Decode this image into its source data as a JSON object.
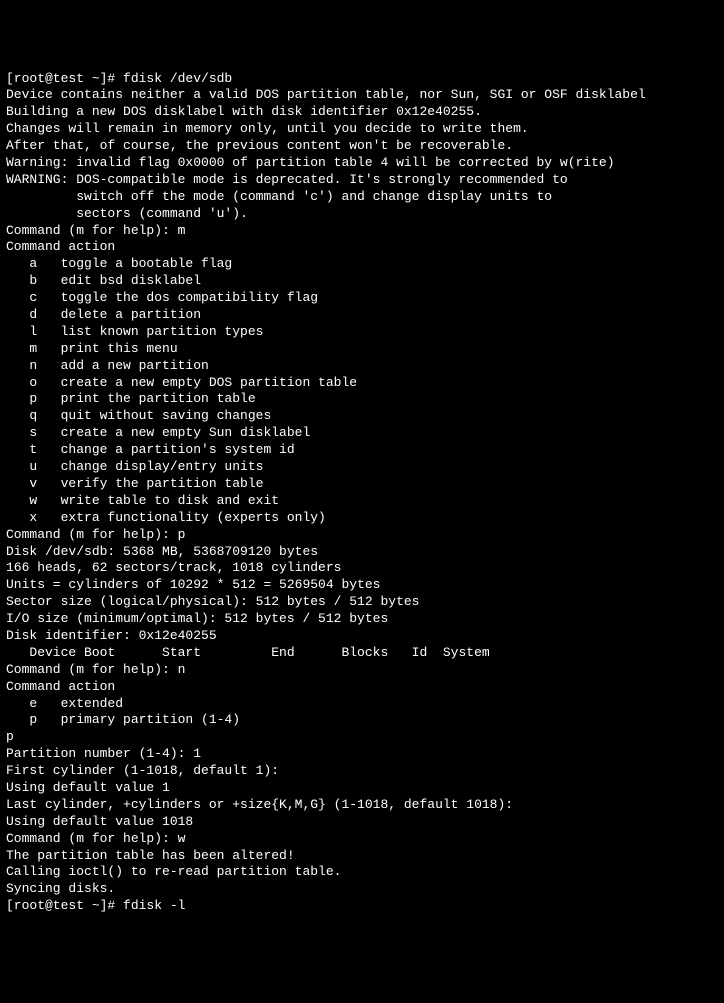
{
  "lines": [
    "[root@test ~]# fdisk /dev/sdb",
    "Device contains neither a valid DOS partition table, nor Sun, SGI or OSF disklabel",
    "Building a new DOS disklabel with disk identifier 0x12e40255.",
    "Changes will remain in memory only, until you decide to write them.",
    "After that, of course, the previous content won't be recoverable.",
    "",
    "Warning: invalid flag 0x0000 of partition table 4 will be corrected by w(rite)",
    "",
    "WARNING: DOS-compatible mode is deprecated. It's strongly recommended to",
    "         switch off the mode (command 'c') and change display units to",
    "         sectors (command 'u').",
    "",
    "Command (m for help): m",
    "Command action",
    "   a   toggle a bootable flag",
    "   b   edit bsd disklabel",
    "   c   toggle the dos compatibility flag",
    "   d   delete a partition",
    "   l   list known partition types",
    "   m   print this menu",
    "   n   add a new partition",
    "   o   create a new empty DOS partition table",
    "   p   print the partition table",
    "   q   quit without saving changes",
    "   s   create a new empty Sun disklabel",
    "   t   change a partition's system id",
    "   u   change display/entry units",
    "   v   verify the partition table",
    "   w   write table to disk and exit",
    "   x   extra functionality (experts only)",
    "",
    "Command (m for help): p",
    "",
    "Disk /dev/sdb: 5368 MB, 5368709120 bytes",
    "166 heads, 62 sectors/track, 1018 cylinders",
    "Units = cylinders of 10292 * 512 = 5269504 bytes",
    "Sector size (logical/physical): 512 bytes / 512 bytes",
    "I/O size (minimum/optimal): 512 bytes / 512 bytes",
    "Disk identifier: 0x12e40255",
    "",
    "   Device Boot      Start         End      Blocks   Id  System",
    "",
    "Command (m for help): n",
    "Command action",
    "   e   extended",
    "   p   primary partition (1-4)",
    "p",
    "Partition number (1-4): 1",
    "First cylinder (1-1018, default 1):",
    "Using default value 1",
    "Last cylinder, +cylinders or +size{K,M,G} (1-1018, default 1018):",
    "Using default value 1018",
    "",
    "Command (m for help): w",
    "The partition table has been altered!",
    "",
    "Calling ioctl() to re-read partition table.",
    "Syncing disks.",
    "[root@test ~]# fdisk -l"
  ]
}
